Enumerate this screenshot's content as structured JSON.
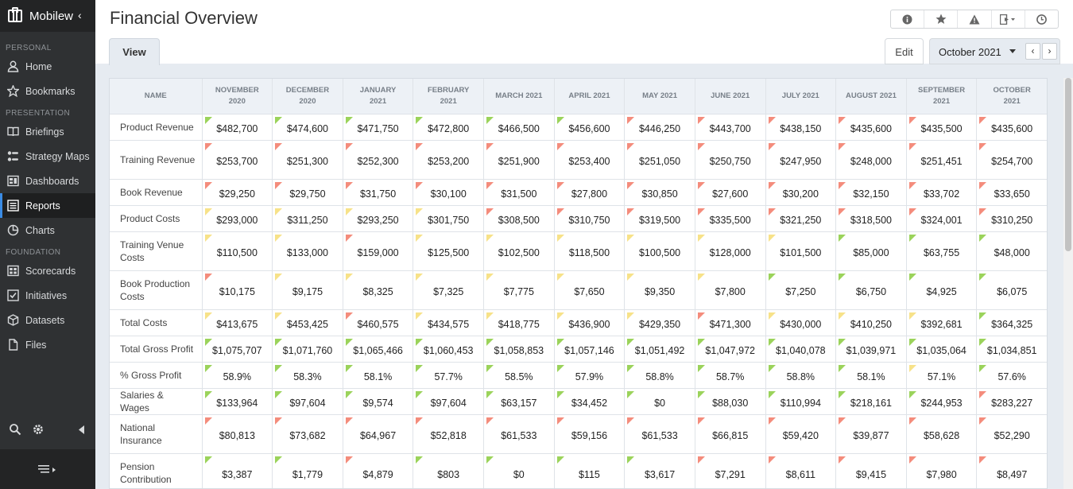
{
  "sidebar": {
    "brand": "Mobilew",
    "sections": {
      "personal": "PERSONAL",
      "presentation": "PRESENTATION",
      "foundation": "FOUNDATION"
    },
    "items": [
      {
        "label": "Home",
        "icon": "user-icon"
      },
      {
        "label": "Bookmarks",
        "icon": "star-icon"
      },
      {
        "label": "Briefings",
        "icon": "book-icon"
      },
      {
        "label": "Strategy Maps",
        "icon": "strategy-map-icon"
      },
      {
        "label": "Dashboards",
        "icon": "dashboard-icon"
      },
      {
        "label": "Reports",
        "icon": "report-icon",
        "active": true
      },
      {
        "label": "Charts",
        "icon": "pie-chart-icon"
      },
      {
        "label": "Scorecards",
        "icon": "scorecard-icon"
      },
      {
        "label": "Initiatives",
        "icon": "checkbox-icon"
      },
      {
        "label": "Datasets",
        "icon": "cube-icon"
      },
      {
        "label": "Files",
        "icon": "file-icon"
      }
    ]
  },
  "header": {
    "title": "Financial Overview",
    "tab_view": "View",
    "edit": "Edit",
    "period": "October 2021"
  },
  "colors": {
    "green": "#9bd35b",
    "yellow": "#f7e289",
    "red": "#f48c7c",
    "accent": "#3a8be4"
  },
  "table": {
    "name_header": "NAME",
    "columns": [
      [
        "NOVEMBER",
        "2020"
      ],
      [
        "DECEMBER",
        "2020"
      ],
      [
        "JANUARY",
        "2021"
      ],
      [
        "FEBRUARY",
        "2021"
      ],
      [
        "MARCH 2021",
        ""
      ],
      [
        "APRIL 2021",
        ""
      ],
      [
        "MAY 2021",
        ""
      ],
      [
        "JUNE 2021",
        ""
      ],
      [
        "JULY 2021",
        ""
      ],
      [
        "AUGUST 2021",
        ""
      ],
      [
        "SEPTEMBER",
        "2021"
      ],
      [
        "OCTOBER",
        "2021"
      ]
    ],
    "rows": [
      {
        "name": "Product Revenue",
        "v": [
          "$482,700",
          "$474,600",
          "$471,750",
          "$472,800",
          "$466,500",
          "$456,600",
          "$446,250",
          "$443,700",
          "$438,150",
          "$435,600",
          "$435,500",
          "$435,600"
        ],
        "s": "ggggggrrrrrr"
      },
      {
        "name": "Training Revenue",
        "v": [
          "$253,700",
          "$251,300",
          "$252,300",
          "$253,200",
          "$251,900",
          "$253,400",
          "$251,050",
          "$250,750",
          "$247,950",
          "$248,000",
          "$251,451",
          "$254,700"
        ],
        "s": "rrrrrrrrrrrr"
      },
      {
        "name": "Book Revenue",
        "v": [
          "$29,250",
          "$29,750",
          "$31,750",
          "$30,100",
          "$31,500",
          "$27,800",
          "$30,850",
          "$27,600",
          "$30,200",
          "$32,150",
          "$33,702",
          "$33,650"
        ],
        "s": "rrrrrrrrrrrr"
      },
      {
        "name": "Product Costs",
        "v": [
          "$293,000",
          "$311,250",
          "$293,250",
          "$301,750",
          "$308,500",
          "$310,750",
          "$319,500",
          "$335,500",
          "$321,250",
          "$318,500",
          "$324,001",
          "$310,250"
        ],
        "s": "yyyyrrrrrrrr"
      },
      {
        "name": "Training Venue Costs",
        "v": [
          "$110,500",
          "$133,000",
          "$159,000",
          "$125,500",
          "$102,500",
          "$118,500",
          "$100,500",
          "$128,000",
          "$101,500",
          "$85,000",
          "$63,755",
          "$48,000"
        ],
        "s": "yyryyyyyygggg"
      },
      {
        "name": "Book Production Costs",
        "v": [
          "$10,175",
          "$9,175",
          "$8,325",
          "$7,325",
          "$7,775",
          "$7,650",
          "$9,350",
          "$7,800",
          "$7,250",
          "$6,750",
          "$4,925",
          "$6,075"
        ],
        "s": "ryyyyyyyggggg"
      },
      {
        "name": "Total Costs",
        "v": [
          "$413,675",
          "$453,425",
          "$460,575",
          "$434,575",
          "$418,775",
          "$436,900",
          "$429,350",
          "$471,300",
          "$430,000",
          "$410,250",
          "$392,681",
          "$364,325"
        ],
        "s": "yyryyyyryyyg"
      },
      {
        "name": "Total Gross Profit",
        "v": [
          "$1,075,707",
          "$1,071,760",
          "$1,065,466",
          "$1,060,453",
          "$1,058,853",
          "$1,057,146",
          "$1,051,492",
          "$1,047,972",
          "$1,040,078",
          "$1,039,971",
          "$1,035,064",
          "$1,034,851"
        ],
        "s": "gggggggggggg"
      },
      {
        "name": "% Gross Profit",
        "v": [
          "58.9%",
          "58.3%",
          "58.1%",
          "57.7%",
          "58.5%",
          "57.9%",
          "58.8%",
          "58.7%",
          "58.8%",
          "58.1%",
          "57.1%",
          "57.6%"
        ],
        "s": "ggggggggggyg"
      },
      {
        "name": "Salaries & Wages",
        "v": [
          "$133,964",
          "$97,604",
          "$9,574",
          "$97,604",
          "$63,157",
          "$34,452",
          "$0",
          "$88,030",
          "$110,994",
          "$218,161",
          "$244,953",
          "$283,227"
        ],
        "s": "gggggggggggr"
      },
      {
        "name": "National Insurance",
        "v": [
          "$80,813",
          "$73,682",
          "$64,967",
          "$52,818",
          "$61,533",
          "$59,156",
          "$61,533",
          "$66,815",
          "$59,420",
          "$39,877",
          "$58,628",
          "$52,290"
        ],
        "s": "rrrrrrrrrrrr"
      },
      {
        "name": "Pension Contribution",
        "v": [
          "$3,387",
          "$1,779",
          "$4,879",
          "$803",
          "$0",
          "$115",
          "$3,617",
          "$7,291",
          "$8,611",
          "$9,415",
          "$7,980",
          "$8,497"
        ],
        "s": "ggrggggrrrrr"
      }
    ]
  }
}
